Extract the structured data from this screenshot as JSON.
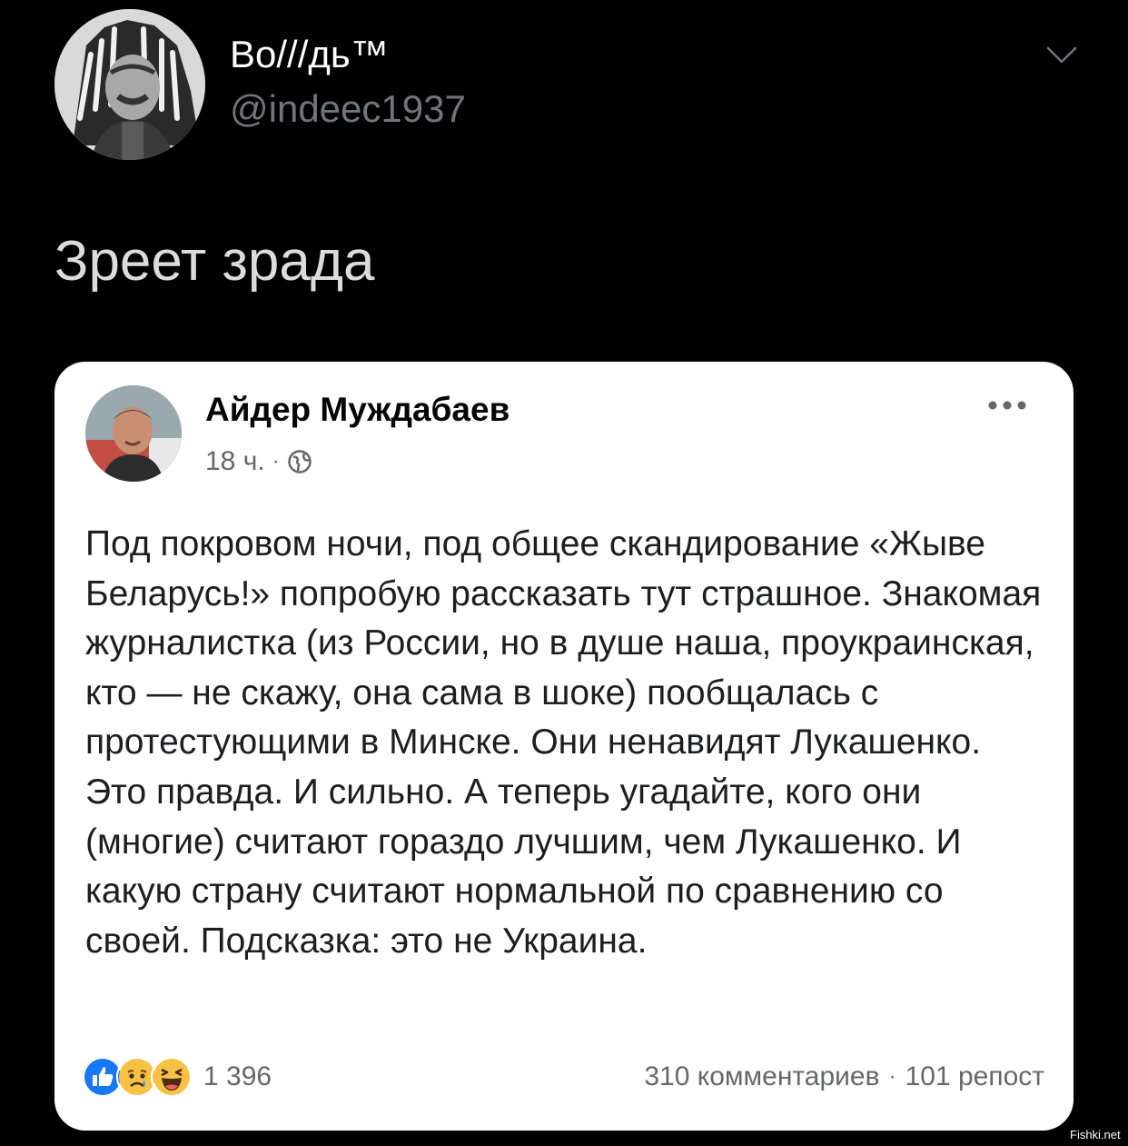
{
  "tweet": {
    "author_name": "Во///дь™",
    "handle": "@indeec1937",
    "text": "Зреет зрада",
    "avatar_icon": "avatar-photo-icon",
    "menu_icon": "chevron-down-icon"
  },
  "facebook_post": {
    "author_name": "Айдер Муждабаев",
    "time": "18 ч.",
    "meta_separator": "·",
    "privacy_icon": "globe-icon",
    "more_icon": "more-dots-icon",
    "body": "Под покровом ночи, под общее скандирование «Жыве Беларусь!» попробую рассказать тут страшное. Знакомая журналистка (из России, но в душе наша, проукраинская, кто — не скажу, она сама в шоке) пообщалась с протестующими в Минске. Они ненавидят Лукашенко. Это правда. И сильно. А теперь угадайте, кого они (многие) считают гораздо лучшим, чем Лукашенко. И какую страну считают нормальной по сравнению со своей. Подсказка: это не Украина.",
    "reactions": {
      "icons": [
        "like-reaction-icon",
        "sad-reaction-icon",
        "haha-reaction-icon"
      ],
      "count": "1 396"
    },
    "comments": "310 комментариев",
    "stats_separator": "·",
    "shares": "101 репост"
  },
  "watermark": "Fishki.net",
  "colors": {
    "background": "#000000",
    "card": "#ffffff",
    "muted_text": "#6e767d",
    "fb_secondary": "#65676b",
    "like_blue": "#1877f2",
    "emoji_yellow": "#f7c244"
  }
}
